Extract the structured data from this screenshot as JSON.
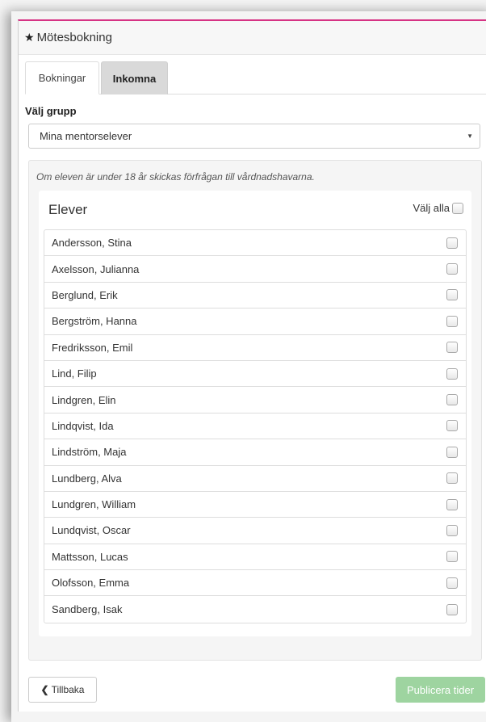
{
  "header": {
    "title": "Mötesbokning",
    "icon": "star-icon"
  },
  "tabs": [
    {
      "label": "Bokningar",
      "active": true
    },
    {
      "label": "Inkomna",
      "active": false
    }
  ],
  "group": {
    "label": "Välj grupp",
    "selected": "Mina mentorselever"
  },
  "note": "Om eleven är under 18 år skickas förfrågan till vårdnadshavarna.",
  "students": {
    "title": "Elever",
    "select_all_label": "Välj alla",
    "items": [
      {
        "name": "Andersson, Stina",
        "checked": false
      },
      {
        "name": "Axelsson, Julianna",
        "checked": false
      },
      {
        "name": "Berglund, Erik",
        "checked": false
      },
      {
        "name": "Bergström, Hanna",
        "checked": false
      },
      {
        "name": "Fredriksson, Emil",
        "checked": false
      },
      {
        "name": "Lind, Filip",
        "checked": false
      },
      {
        "name": "Lindgren, Elin",
        "checked": false
      },
      {
        "name": "Lindqvist, Ida",
        "checked": false
      },
      {
        "name": "Lindström, Maja",
        "checked": false
      },
      {
        "name": "Lundberg, Alva",
        "checked": false
      },
      {
        "name": "Lundgren, William",
        "checked": false
      },
      {
        "name": "Lundqvist, Oscar",
        "checked": false
      },
      {
        "name": "Mattsson, Lucas",
        "checked": false
      },
      {
        "name": "Olofsson, Emma",
        "checked": false
      },
      {
        "name": "Sandberg, Isak",
        "checked": false
      }
    ]
  },
  "buttons": {
    "back_label": "Tillbaka",
    "publish_label": "Publicera tider"
  },
  "colors": {
    "accent_line": "#d63384",
    "publish_button": "#9ed4a0"
  }
}
